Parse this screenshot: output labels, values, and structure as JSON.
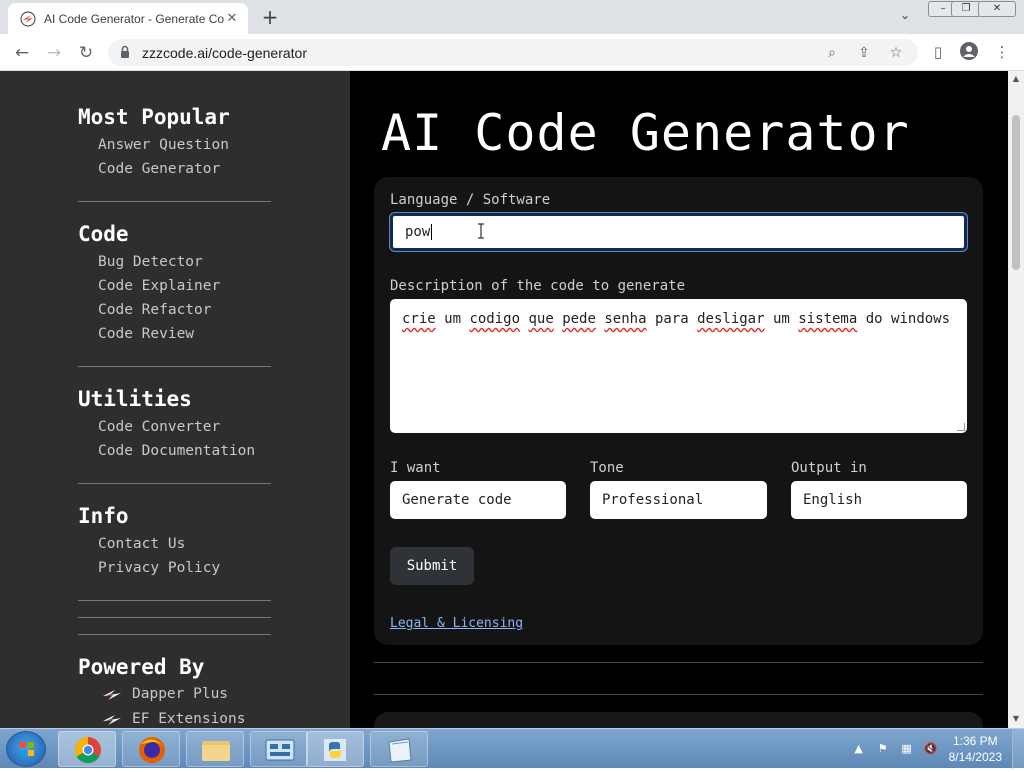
{
  "browser": {
    "tab_title": "AI Code Generator - Generate Code",
    "new_tab": "+",
    "url": "zzzcode.ai/code-generator"
  },
  "sidebar": {
    "sections": [
      {
        "heading": "Most Popular",
        "links": [
          "Answer Question",
          "Code Generator"
        ]
      },
      {
        "heading": "Code",
        "links": [
          "Bug Detector",
          "Code Explainer",
          "Code Refactor",
          "Code Review"
        ]
      },
      {
        "heading": "Utilities",
        "links": [
          "Code Converter",
          "Code Documentation"
        ]
      },
      {
        "heading": "Info",
        "links": [
          "Contact Us",
          "Privacy Policy"
        ]
      }
    ],
    "powered_by": {
      "heading": "Powered By",
      "links": [
        "Dapper Plus",
        "EF Extensions"
      ]
    }
  },
  "main": {
    "title": "AI Code Generator",
    "language_label": "Language / Software",
    "language_value": "pow",
    "description_label": "Description of the code to generate",
    "description_words": [
      "crie",
      "um",
      "codigo",
      "que",
      "pede",
      "senha",
      "para",
      "desligar",
      "um",
      "sistema",
      "do",
      "windows"
    ],
    "i_want_label": "I want",
    "i_want_value": "Generate code",
    "tone_label": "Tone",
    "tone_value": "Professional",
    "output_label": "Output in",
    "output_value": "English",
    "submit_label": "Submit",
    "legal_link": "Legal & Licensing"
  },
  "taskbar": {
    "time": "1:36 PM",
    "date": "8/14/2023"
  },
  "colors": {
    "sidebar_bg": "#2e2e2e",
    "page_bg": "#000000",
    "card_bg": "#141414",
    "link": "#8ab4f8"
  }
}
